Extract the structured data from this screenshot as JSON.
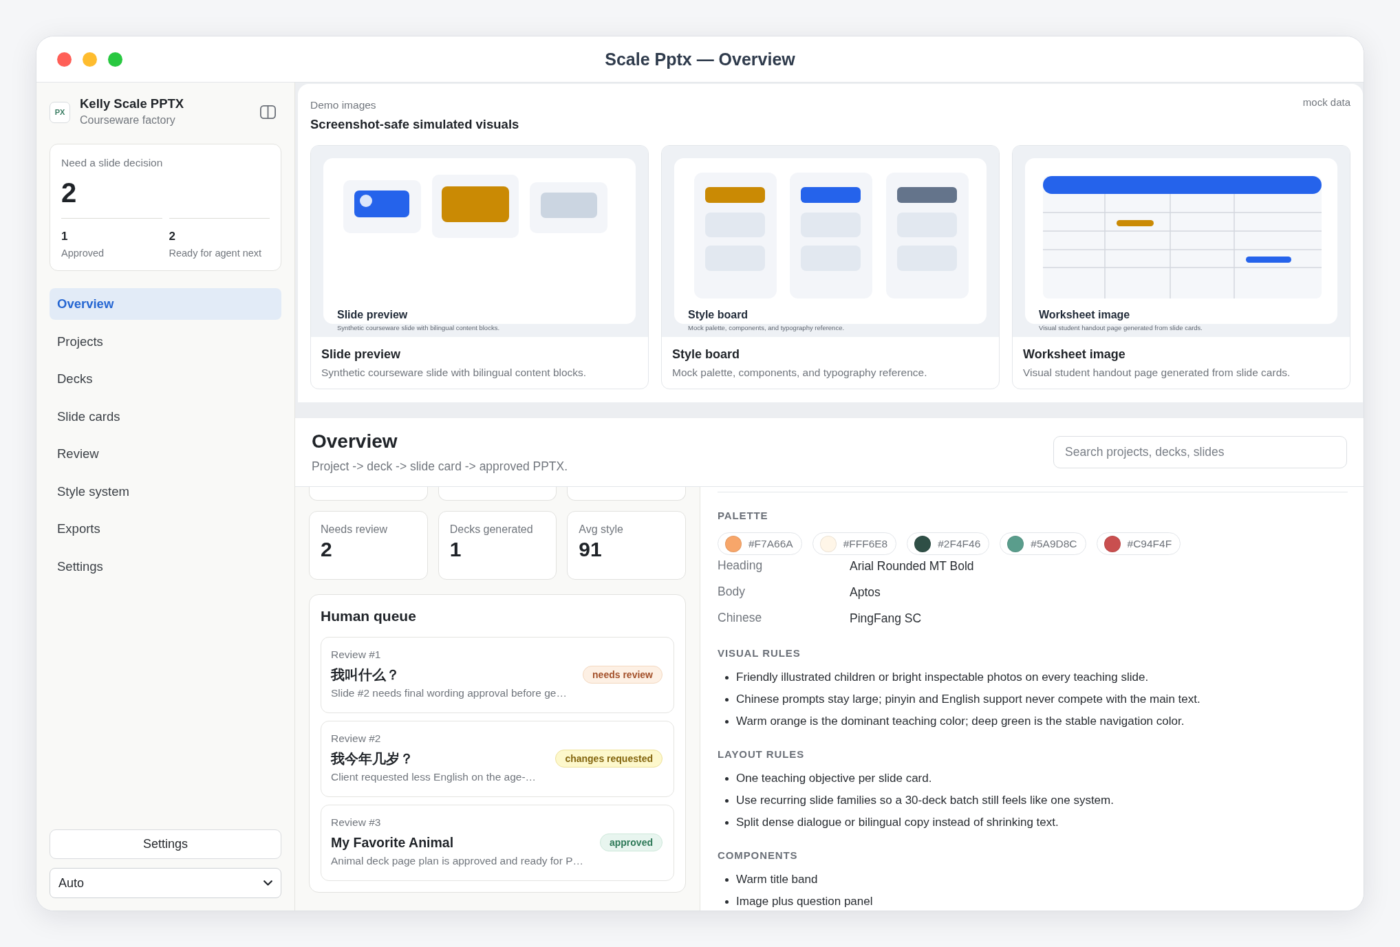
{
  "window": {
    "title": "Scale Pptx — Overview"
  },
  "sidebar": {
    "brand": {
      "logo": "PX",
      "name": "Kelly Scale PPTX",
      "subtitle": "Courseware factory"
    },
    "decision_card": {
      "label": "Need a slide decision",
      "value": "2",
      "stats": [
        {
          "value": "1",
          "label": "Approved"
        },
        {
          "value": "2",
          "label": "Ready for agent next"
        }
      ]
    },
    "nav": [
      {
        "label": "Overview",
        "selected": true
      },
      {
        "label": "Projects",
        "selected": false
      },
      {
        "label": "Decks",
        "selected": false
      },
      {
        "label": "Slide cards",
        "selected": false
      },
      {
        "label": "Review",
        "selected": false
      },
      {
        "label": "Style system",
        "selected": false
      },
      {
        "label": "Exports",
        "selected": false
      },
      {
        "label": "Settings",
        "selected": false
      }
    ],
    "settings_button": "Settings",
    "theme_select": {
      "value": "Auto"
    }
  },
  "demo_images": {
    "eyebrow": "Demo images",
    "title": "Screenshot-safe simulated visuals",
    "tag": "mock data",
    "cards": [
      {
        "kind": "slide",
        "preview_title": "Slide preview",
        "preview_caption": "Synthetic courseware slide with bilingual content blocks.",
        "title": "Slide preview",
        "description": "Synthetic courseware slide with bilingual content blocks."
      },
      {
        "kind": "style_board",
        "preview_title": "Style board",
        "preview_caption": "Mock palette, components, and typography reference.",
        "title": "Style board",
        "description": "Mock palette, components, and typography reference."
      },
      {
        "kind": "worksheet",
        "preview_title": "Worksheet image",
        "preview_caption": "Visual student handout page generated from slide cards.",
        "title": "Worksheet image",
        "description": "Visual student handout page generated from slide cards."
      }
    ]
  },
  "overview": {
    "title": "Overview",
    "subtitle": "Project -> deck -> slide card -> approved PPTX.",
    "search": {
      "placeholder": "Search projects, decks, slides"
    },
    "stats": [
      {
        "label": "Needs review",
        "value": "2"
      },
      {
        "label": "Decks generated",
        "value": "1"
      },
      {
        "label": "Avg style",
        "value": "91"
      }
    ],
    "human_queue": {
      "title": "Human queue",
      "items": [
        {
          "label": "Review #1",
          "title": "我叫什么？",
          "description": "Slide #2 needs final wording approval before ge…",
          "status": {
            "text": "needs review",
            "kind": "pending"
          }
        },
        {
          "label": "Review #2",
          "title": "我今年几岁？",
          "description": "Client requested less English on the age-…",
          "status": {
            "text": "changes requested",
            "kind": "changes"
          }
        },
        {
          "label": "Review #3",
          "title": "My Favorite Animal",
          "description": "Animal deck page plan is approved and ready for P…",
          "status": {
            "text": "approved",
            "kind": "approved"
          }
        }
      ]
    },
    "style_guide": {
      "palette_title": "PALETTE",
      "palette": [
        {
          "color": "#f7a66a",
          "label": "#F7A66A"
        },
        {
          "color": "#fff6e8",
          "label": "#FFF6E8"
        },
        {
          "color": "#2f4f46",
          "label": "#2F4F46"
        },
        {
          "color": "#5a9d8c",
          "label": "#5A9D8C"
        },
        {
          "color": "#c94f4f",
          "label": "#C94F4F"
        }
      ],
      "fonts": [
        {
          "role": "Heading",
          "value": "Arial Rounded MT Bold"
        },
        {
          "role": "Body",
          "value": "Aptos"
        },
        {
          "role": "Chinese",
          "value": "PingFang SC"
        }
      ],
      "sections": [
        {
          "title": "VISUAL RULES",
          "items": [
            "Friendly illustrated children or bright inspectable photos on every teaching slide.",
            "Chinese prompts stay large; pinyin and English support never compete with the main text.",
            "Warm orange is the dominant teaching color; deep green is the stable navigation color."
          ]
        },
        {
          "title": "LAYOUT RULES",
          "items": [
            "One teaching objective per slide card.",
            "Use recurring slide families so a 30-deck batch still feels like one system.",
            "Split dense dialogue or bilingual copy instead of shrinking text."
          ]
        },
        {
          "title": "COMPONENTS",
          "items": [
            "Warm title band",
            "Image plus question panel"
          ]
        }
      ]
    }
  }
}
